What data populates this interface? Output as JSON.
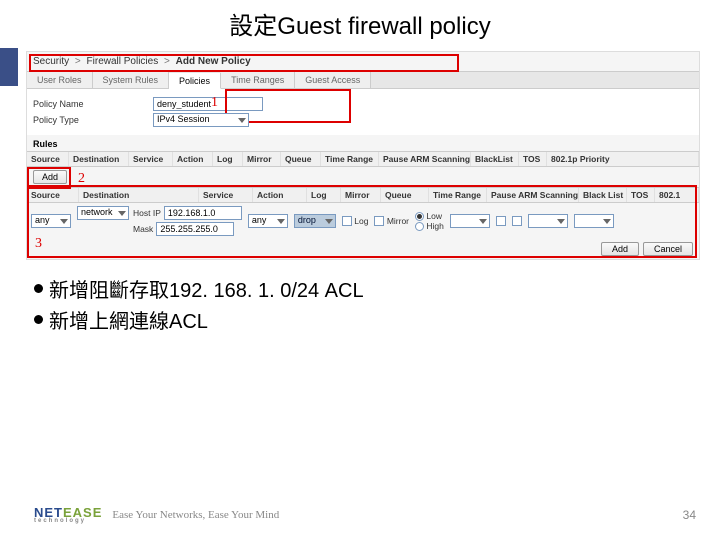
{
  "slide": {
    "title": "設定Guest firewall policy",
    "page_number": "34"
  },
  "breadcrumb": {
    "a": "Security",
    "b": "Firewall Policies",
    "c": "Add New Policy"
  },
  "tabs": [
    "User Roles",
    "System Rules",
    "Policies",
    "Time Ranges",
    "Guest Access"
  ],
  "policy": {
    "name_label": "Policy Name",
    "name_value": "deny_student",
    "type_label": "Policy Type",
    "type_value": "IPv4 Session",
    "rules_label": "Rules"
  },
  "hdr1": [
    "Source",
    "Destination",
    "Service",
    "Action",
    "Log",
    "Mirror",
    "Queue",
    "Time Range",
    "Pause ARM Scanning",
    "BlackList",
    "TOS",
    "802.1p Priority"
  ],
  "add_label": "Add",
  "hdr2": [
    "Source",
    "Destination",
    "Service",
    "Action",
    "Log",
    "Mirror",
    "Queue",
    "Time Range",
    "Pause ARM Scanning",
    "Black List",
    "TOS",
    "802.1"
  ],
  "edit": {
    "source": "any",
    "dest_type": "network",
    "host_ip_label": "Host IP",
    "host_ip": "192.168.1.0",
    "mask_label": "Mask",
    "mask": "255.255.255.0",
    "service": "any",
    "action": "drop",
    "log_label": "Log",
    "mirror_label": "Mirror",
    "queue_low": "Low",
    "queue_high": "High",
    "blacklist_label": ""
  },
  "buttons": {
    "add": "Add",
    "cancel": "Cancel"
  },
  "annot": {
    "n1": "1",
    "n2": "2",
    "n3": "3"
  },
  "bullets": {
    "b1": "新增阻斷存取192. 168. 1. 0/24 ACL",
    "b2": "新增上網連線ACL"
  },
  "footer": {
    "logo1": "NET",
    "logo2": "EASE",
    "logo_sub": "technology",
    "tagline": "Ease Your Networks, Ease Your Mind"
  }
}
